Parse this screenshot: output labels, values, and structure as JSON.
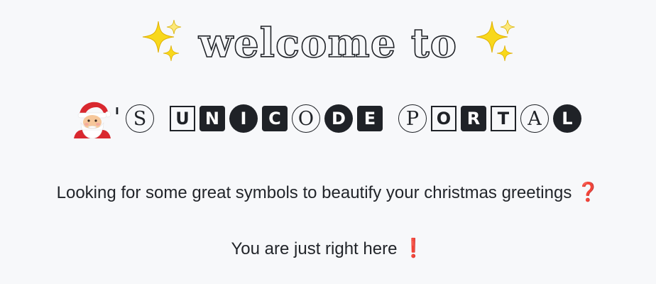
{
  "title": {
    "sparkle_left": "✨",
    "text": "welcome to",
    "sparkle_right": "✨"
  },
  "portal": {
    "santa_icon": "santa-emoji",
    "apostrophe": "'",
    "letters": [
      {
        "char": "S",
        "style": "circle-outline"
      },
      {
        "char": "U",
        "style": "square-outline"
      },
      {
        "char": "N",
        "style": "square-filled"
      },
      {
        "char": "I",
        "style": "circle-filled"
      },
      {
        "char": "C",
        "style": "square-filled"
      },
      {
        "char": "O",
        "style": "circle-outline"
      },
      {
        "char": "D",
        "style": "circle-filled"
      },
      {
        "char": "E",
        "style": "square-filled"
      },
      {
        "char": "P",
        "style": "circle-outline"
      },
      {
        "char": "O",
        "style": "square-outline"
      },
      {
        "char": "R",
        "style": "square-filled"
      },
      {
        "char": "T",
        "style": "square-outline"
      },
      {
        "char": "A",
        "style": "circle-outline"
      },
      {
        "char": "L",
        "style": "circle-filled"
      }
    ]
  },
  "paragraphs": {
    "line1_text": "Looking for some great symbols to beautify your christmas greetings",
    "line1_mark": "❓",
    "line2_text": "You are just right here",
    "line2_mark": "❗"
  },
  "colors": {
    "background": "#f7f8fa",
    "text": "#1f2227",
    "sparkle": "#f5c90a",
    "mark_red": "#d4242e"
  }
}
